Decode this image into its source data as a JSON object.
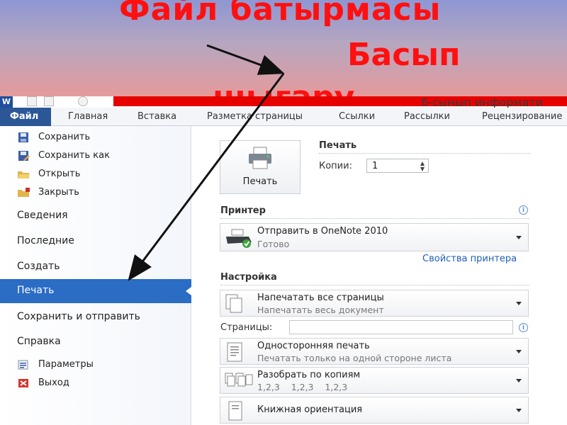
{
  "slide": {
    "title_line1": "Файл батырмасы",
    "title_line2": "Басып",
    "title_line3": "шығару"
  },
  "window": {
    "app_icon_letter": "W",
    "doc_title": "6-сынып информати"
  },
  "ribbon": {
    "file_tab": "Файл",
    "tabs": [
      "Главная",
      "Вставка",
      "Разметка страницы",
      "Ссылки",
      "Рассылки",
      "Рецензирование"
    ]
  },
  "sidebar": {
    "commands": [
      {
        "label": "Сохранить",
        "icon": "save-icon"
      },
      {
        "label": "Сохранить как",
        "icon": "save-as-icon"
      },
      {
        "label": "Открыть",
        "icon": "open-folder-icon"
      },
      {
        "label": "Закрыть",
        "icon": "close-folder-icon"
      }
    ],
    "sections": [
      "Сведения",
      "Последние",
      "Создать",
      "Печать",
      "Сохранить и отправить",
      "Справка"
    ],
    "active_section": "Печать",
    "bottom": [
      {
        "label": "Параметры",
        "icon": "options-icon"
      },
      {
        "label": "Выход",
        "icon": "exit-icon"
      }
    ]
  },
  "print": {
    "button_label": "Печать",
    "section_title": "Печать",
    "copies_label": "Копии:",
    "copies_value": "1",
    "printer_title": "Принтер",
    "printer_name": "Отправить в OneNote 2010",
    "printer_status": "Готово",
    "printer_properties": "Свойства принтера",
    "settings_title": "Настройка",
    "settings": [
      {
        "line1": "Напечатать все страницы",
        "line2": "Напечатать весь документ"
      },
      {
        "line1": "Односторонняя печать",
        "line2": "Печатать только на одной стороне листа"
      },
      {
        "line1": "Разобрать по копиям",
        "line2": "1,2,3    1,2,3    1,2,3"
      },
      {
        "line1": "Книжная ориентация",
        "line2": ""
      }
    ],
    "pages_label": "Страницы:",
    "pages_value": ""
  },
  "colors": {
    "file_tab": "#2b5797",
    "active_section": "#2b6cc4",
    "title_red": "#ff1010",
    "link_blue": "#1d5fb6"
  }
}
